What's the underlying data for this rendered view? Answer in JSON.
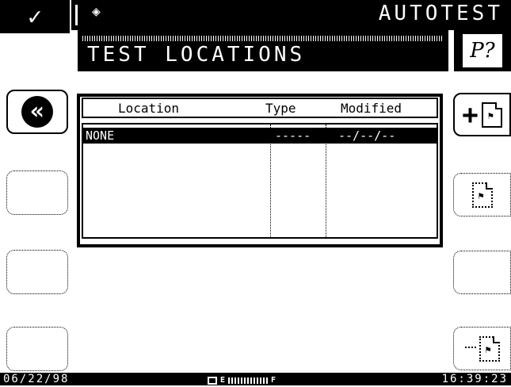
{
  "header": {
    "app_title": "AUTOTEST",
    "screen_title": "TEST LOCATIONS",
    "ok_glyph": "✓",
    "diamond_glyph": "◈",
    "help_glyph": "P?"
  },
  "softkeys": {
    "back_glyph": "«",
    "add_glyph": "+"
  },
  "table": {
    "columns": [
      "Location",
      "Type",
      "Modified"
    ],
    "rows": [
      {
        "location": "NONE",
        "type": "-----",
        "modified": "--/--/--",
        "selected": true
      }
    ]
  },
  "status": {
    "date": "06/22/98",
    "battery_empty": "E",
    "battery_full": "F",
    "time": "16:39:23"
  },
  "icons": {
    "ok": "check-icon",
    "back": "double-chevron-left-icon",
    "help": "help-icon",
    "add": "add-document-icon",
    "edit": "edit-document-icon",
    "remove": "remove-document-icon",
    "battery": "battery-icon"
  },
  "colors": {
    "background": "#ffffff",
    "foreground": "#000000"
  }
}
